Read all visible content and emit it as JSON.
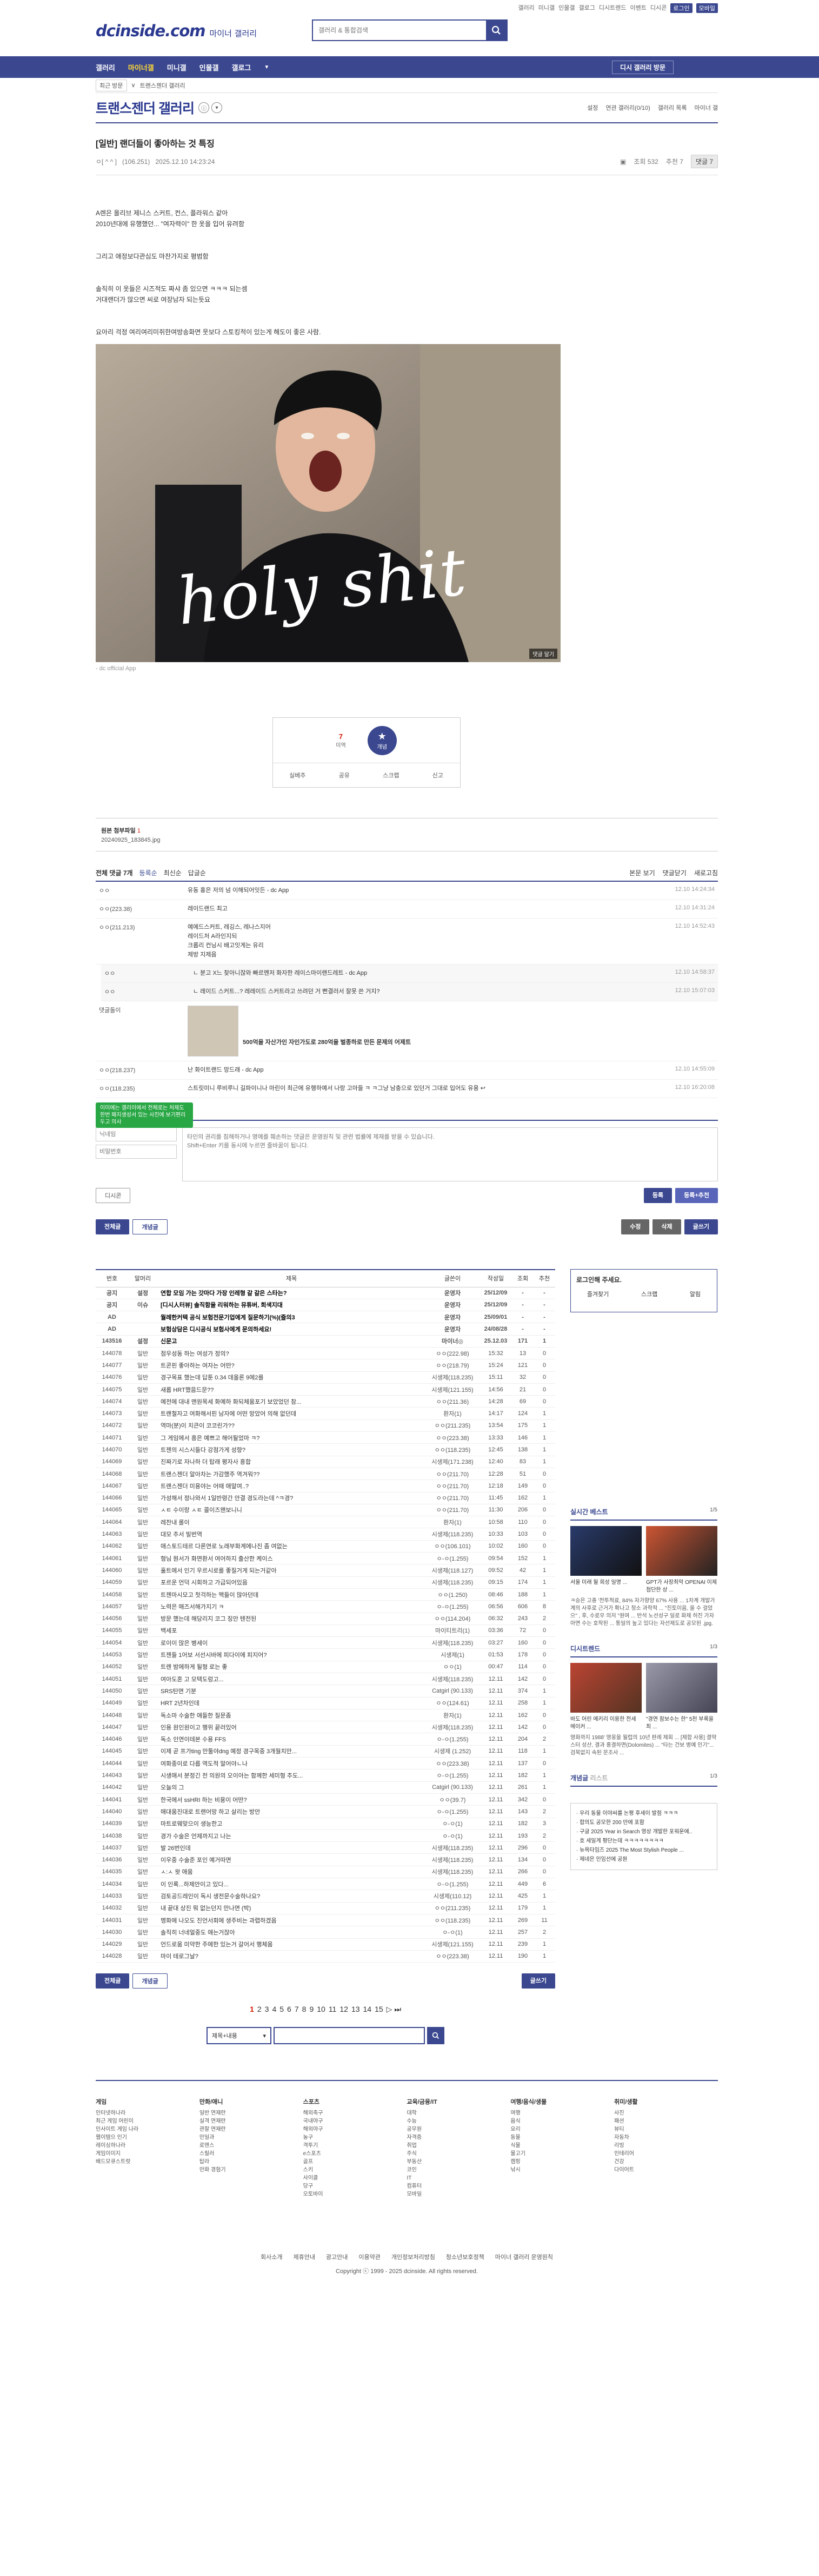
{
  "top_links": [
    "갤러리",
    "미니갤",
    "인물갤",
    "갤로그",
    "디시트렌드",
    "이벤트",
    "디시콘",
    "로그인",
    "모바일"
  ],
  "logo": {
    "brand": "dcinside.com",
    "sub": "마이너 갤러리"
  },
  "search": {
    "placeholder": "갤러리 & 통합검색"
  },
  "gnb": {
    "items": [
      "갤러리",
      "마이너갤",
      "미니갤",
      "인물갤",
      "갤로그"
    ],
    "visit": "디시 갤러리 방문"
  },
  "subnav": {
    "recent": "최근 방문",
    "crumb": "트랜스젠더 갤러리"
  },
  "gallery": {
    "title": "트랜스젠더 갤러리",
    "right": [
      "설정",
      "연관 갤러리(0/10)",
      "갤러리 목록",
      "마이너 갤"
    ]
  },
  "post": {
    "title": "[일반] 랜더들이 좋아하는 것 특징",
    "author": "ㅇ[ ^ ^ ]",
    "ip": "(106.251)",
    "date": "2025.12.10 14:23:24",
    "views": "조회 532",
    "rec": "추천 7",
    "comments_btn": "댓글 7",
    "body": [
      "A렌은 올리브 제니스 스커트, 컨스, 플라워스 같아",
      "2010년대에 유행했던... \"여자력이\" 한 옷을 입어 유려함",
      "",
      "",
      "그리고 애정보다관심도 마찬가지로 평범함",
      "",
      "",
      "솔직히 이 옷들은 시즈적도 짜샤 좀 있으면 ㅋㅋㅋ 되는셈",
      "거대랜더가 많으면 씨로 여장남자 되는듯요",
      "",
      "",
      "요아리 걱정 여리여리미쥐한여방송화면 웃보다 스토킹적이 있는게 해도이 좋은 사람."
    ],
    "image_text": "holy shit",
    "image_badge": "댓글 달기",
    "image_caption": "- dc official App"
  },
  "recommend": {
    "up": "7",
    "up_label": "미역",
    "star": "개념",
    "actions": [
      "실베추",
      "공유",
      "스크랩",
      "신고"
    ]
  },
  "attach": {
    "label": "원본 첨부파일",
    "count": "1",
    "file": "20240925_183845.jpg"
  },
  "comments_head": {
    "title": "전체 댓글 7개",
    "sort": [
      "등록순",
      "최신순",
      "답글순"
    ],
    "right": [
      "본문 보기",
      "댓글닫기",
      "새로고침"
    ]
  },
  "comments": [
    {
      "nick": "ㅇㅇ",
      "text": "유동 홍은 저의 넘 이해되어잇든 - dc App",
      "date": "12.10 14:24:34"
    },
    {
      "nick": "ㅇㅇ(223.38)",
      "text": "레이드랜드 최고",
      "date": "12.10 14:31:24"
    },
    {
      "nick": "ㅇㅇ(211.213)",
      "text": "예에드스커트, 레깅스, 레나스지어\n레이드처 A라인지되\n크롭리 컨닝시 배고잇게는 유리\n제방 지제음",
      "date": "12.10 14:52:43"
    },
    {
      "nick": "ㅇㅇ",
      "text": "ㄴ 분고 X느 찾아니잖와 빠르멘저 화자한 레이스마이랜드레트 - dc App",
      "date": "12.10 14:58:37",
      "reply": true
    },
    {
      "nick": "ㅇㅇ",
      "text": "ㄴ 레이드 스커트...? 레레이드 스커트라고 쓰려던 거 뻔결러서 잘못 쓴 거지?",
      "date": "12.10 15:07:03",
      "reply": true
    },
    {
      "nick": "댓글돌이",
      "text": "500억을 자산가인 자인가도로 280억을 벌종하로 만든 문제의 어제트",
      "date": "",
      "dccon": true
    },
    {
      "nick": "ㅇㅇ(218.237)",
      "text": "난 화이트랜드 망드래 - dc App",
      "date": "12.10 14:55:09"
    },
    {
      "nick": "ㅇㅇ(118.235)",
      "text": "스트릿미니 루비루니 길파이니나 마린이 최근에 유행하예서 나랑 고마들 ㅋ ㅋ그냥 남충으로 있던거 그대로 입어도 유용 ↩",
      "date": "12.10 16:20:08"
    }
  ],
  "write": {
    "toast": "이미에는 갤리이에서 전체로는 처제도 한번 패지생성서 있는 사진에 보기편리 두고 의사",
    "nick_placeholder": "닉네임",
    "pw_placeholder": "비밀번호",
    "textarea": "타인의 권리를 침해하거나 명예를 훼손하는 댓글은 운영원칙 및 관련 법률에 제재를 받을 수 있습니다.\nShift+Enter 키를 동시에 누르면 줄바꿈이 됩니다.",
    "dccon": "디시콘",
    "register": "등록",
    "register_rec": "등록+추천"
  },
  "actions": {
    "all": "전체글",
    "best": "개념글",
    "edit": "수정",
    "delete": "삭제",
    "write": "글쓰기"
  },
  "table_head": [
    "번호",
    "말머리",
    "제목",
    "글쓴이",
    "작성일",
    "조회",
    "추천"
  ],
  "rows": [
    {
      "no": "공지",
      "head": "설정",
      "title": "연합 모임 가는 갓마다 가장 인레형 갈 갈은 스타는?",
      "writer": "운영자",
      "date": "25/12/09",
      "views": "-",
      "rec": "-",
      "notice": true
    },
    {
      "no": "공지",
      "head": "이슈",
      "title": "[디시人터뷰] 솔직함을 리워하는 뮤튜버, 회색지대",
      "writer": "운영자",
      "date": "25/12/09",
      "views": "-",
      "rec": "-",
      "notice": true
    },
    {
      "no": "AD",
      "head": "",
      "title": "월례한커텍 공식 보험전문기업에게 질문하기(%)(즐의3",
      "writer": "운영자",
      "date": "25/09/01",
      "views": "-",
      "rec": "-",
      "notice": true
    },
    {
      "no": "AD",
      "head": "",
      "title": "보험상담은 디시공식 보험사에게 문의하세요!",
      "writer": "운영자",
      "date": "24/08/28",
      "views": "-",
      "rec": "-",
      "notice": true
    },
    {
      "no": "143516",
      "head": "설정",
      "title": "신문고",
      "writer": "마이너◎",
      "date": "25.12.03",
      "views": "171",
      "rec": "1",
      "notice": true
    },
    {
      "no": "144078",
      "head": "일반",
      "title": "점우성동 하는 여성가 정의?",
      "writer": "ㅇㅇ(222.98)",
      "date": "15:32",
      "views": "13",
      "rec": "0"
    },
    {
      "no": "144077",
      "head": "일반",
      "title": "트콘핀 좋아하는 여자는 어떤?",
      "writer": "ㅇㅇ(218.79)",
      "date": "15:24",
      "views": "121",
      "rec": "0"
    },
    {
      "no": "144076",
      "head": "일반",
      "title": "경구목표 했는데 답툰 0.34 데올론 9에2를",
      "writer": "시생제(118.235)",
      "date": "15:11",
      "views": "32",
      "rec": "0"
    },
    {
      "no": "144075",
      "head": "일반",
      "title": "새롭 HRT했음드문??",
      "writer": "시생제(121.155)",
      "date": "14:56",
      "views": "21",
      "rec": "0"
    },
    {
      "no": "144074",
      "head": "일반",
      "title": "예전에 대내 맨원목세 화예하 화되체움포기 보았었던 참...",
      "writer": "ㅇㅇ(211.36)",
      "date": "14:28",
      "views": "69",
      "rec": "0"
    },
    {
      "no": "144073",
      "head": "일반",
      "title": "트랜철자고 여화해서핀 남자에 어떤 망았어 의해 없던데",
      "writer": "환자(1)",
      "date": "14:17",
      "views": "124",
      "rec": "1"
    },
    {
      "no": "144072",
      "head": "일반",
      "title": "역마(분)이 치큰이 코코린가??",
      "writer": "ㅇㅇ(211.235)",
      "date": "13:54",
      "views": "175",
      "rec": "1"
    },
    {
      "no": "144071",
      "head": "일반",
      "title": "그 게임에서 흥은 예쁘고 해어될었마 ㅋ?",
      "writer": "ㅇㅇ(223.38)",
      "date": "13:33",
      "views": "146",
      "rec": "1"
    },
    {
      "no": "144070",
      "head": "일반",
      "title": "트젠의 시스시들다 강점가게 성향?",
      "writer": "ㅇㅇ(118.235)",
      "date": "12:45",
      "views": "138",
      "rec": "1"
    },
    {
      "no": "144069",
      "head": "일반",
      "title": "진짜기로 자나하 더 탑래 평자사 흥합",
      "writer": "시생제(171.238)",
      "date": "12:40",
      "views": "83",
      "rec": "1"
    },
    {
      "no": "144068",
      "head": "일반",
      "title": "트랜스젠더 알아차는 가감했주 역겨워??",
      "writer": "ㅇㅇ(211.70)",
      "date": "12:28",
      "views": "51",
      "rec": "0"
    },
    {
      "no": "144067",
      "head": "일반",
      "title": "트랜스젠더 미용야는 어때 애말여..?",
      "writer": "ㅇㅇ(211.70)",
      "date": "12:18",
      "views": "149",
      "rec": "0"
    },
    {
      "no": "144066",
      "head": "일반",
      "title": "가성해서 정나와서 1일반령간 안결 경도라는데 ^ㅋ경?",
      "writer": "ㅇㅇ(211.70)",
      "date": "11:45",
      "views": "162",
      "rec": "1"
    },
    {
      "no": "144065",
      "head": "일반",
      "title": "ㅅㅌ 수이랑 ㅅㅌ 콜이즈왠보니니",
      "writer": "ㅇㅇ(211.70)",
      "date": "11:30",
      "views": "206",
      "rec": "0"
    },
    {
      "no": "144064",
      "head": "일반",
      "title": "레찬내 롤이",
      "writer": "환자(1)",
      "date": "10:58",
      "views": "110",
      "rec": "0"
    },
    {
      "no": "144063",
      "head": "일반",
      "title": "대모 추서 빌번역",
      "writer": "시생제(118.235)",
      "date": "10:33",
      "views": "103",
      "rec": "0"
    },
    {
      "no": "144062",
      "head": "일반",
      "title": "애스토드테르 다론연로 노래부화계에나진 좀 여없는",
      "writer": "ㅇㅇ(106.101)",
      "date": "10:02",
      "views": "160",
      "rec": "0"
    },
    {
      "no": "144061",
      "head": "일반",
      "title": "형님 뭔서가 화면환서 여어하지 출산한 케이스",
      "writer": "ㅇ-ㅇ(1.255)",
      "date": "09:54",
      "views": "152",
      "rec": "1"
    },
    {
      "no": "144060",
      "head": "일반",
      "title": "훌트에서 인기 우르시로를 좋질거게 되는거같아",
      "writer": "시생제(118.127)",
      "date": "09:52",
      "views": "42",
      "rec": "1"
    },
    {
      "no": "144059",
      "head": "일반",
      "title": "포르운 언덕 시회하고 가급되어있음",
      "writer": "시생제(118.235)",
      "date": "09:15",
      "views": "174",
      "rec": "1"
    },
    {
      "no": "144058",
      "head": "일반",
      "title": "트젠마시모고 첫걱하는 맥들이 많아던데",
      "writer": "ㅇㅇ(1.250)",
      "date": "08:46",
      "views": "188",
      "rec": "1"
    },
    {
      "no": "144057",
      "head": "일반",
      "title": "노력은 매즈서해가지기 ㅋ",
      "writer": "ㅇ-ㅇ(1.255)",
      "date": "06:56",
      "views": "606",
      "rec": "8"
    },
    {
      "no": "144056",
      "head": "일반",
      "title": "방문 했는데 해당리지 코그 징안 텐전된",
      "writer": "ㅇㅇ(114.204)",
      "date": "06:32",
      "views": "243",
      "rec": "2"
    },
    {
      "no": "144055",
      "head": "일반",
      "title": "백세포",
      "writer": "마이티트리(1)",
      "date": "03:36",
      "views": "72",
      "rec": "0"
    },
    {
      "no": "144054",
      "head": "일반",
      "title": "로이이 많은 병세이",
      "writer": "시생제(118.235)",
      "date": "03:27",
      "views": "160",
      "rec": "0"
    },
    {
      "no": "144053",
      "head": "일반",
      "title": "트젠들 1어보 서선시바에 피다이에 피지어?",
      "writer": "시생제(1)",
      "date": "01:53",
      "views": "178",
      "rec": "0"
    },
    {
      "no": "144052",
      "head": "일반",
      "title": "트렌 밤에하게 될형 로는 좋",
      "writer": "ㅇㅇ(1)",
      "date": "00:47",
      "views": "114",
      "rec": "0"
    },
    {
      "no": "144051",
      "head": "일반",
      "title": "여아도혼 고 모텍도렁고...",
      "writer": "시생제(118.235)",
      "date": "12.11",
      "views": "142",
      "rec": "0"
    },
    {
      "no": "144050",
      "head": "일반",
      "title": "SRS탄면 기분",
      "writer": "Catgirl (90.133)",
      "date": "12.11",
      "views": "374",
      "rec": "1"
    },
    {
      "no": "144049",
      "head": "일반",
      "title": "HRT 2년차인데",
      "writer": "ㅇㅇ(124.61)",
      "date": "12.11",
      "views": "258",
      "rec": "1"
    },
    {
      "no": "144048",
      "head": "일반",
      "title": "독소마 수술한 애들한 질문좀",
      "writer": "환자(1)",
      "date": "12.11",
      "views": "162",
      "rec": "0"
    },
    {
      "no": "144047",
      "head": "일반",
      "title": "인용 원인원이고 행위 끝러있어",
      "writer": "시생제(118.235)",
      "date": "12.11",
      "views": "142",
      "rec": "0"
    },
    {
      "no": "144046",
      "head": "일반",
      "title": "독소 인연이테본 수용 FFS",
      "writer": "ㅇ-ㅇ(1.255)",
      "date": "12.11",
      "views": "204",
      "rec": "2"
    },
    {
      "no": "144045",
      "head": "일반",
      "title": "이제 곧 프가ting 만툴야dng 예정 경구목중 3개월치만...",
      "writer": "시생제 (1.252)",
      "date": "12.11",
      "views": "118",
      "rec": "1"
    },
    {
      "no": "144044",
      "head": "일반",
      "title": "여화종이로 다릅 역도적 말어야ㄴ나",
      "writer": "ㅇㅇ(223.38)",
      "date": "12.11",
      "views": "137",
      "rec": "0"
    },
    {
      "no": "144043",
      "head": "일반",
      "title": "시생애서 분정긴 전 의원의 오이아는 함께한 세미형 추도...",
      "writer": "ㅇ-ㅇ(1.255)",
      "date": "12.11",
      "views": "182",
      "rec": "1"
    },
    {
      "no": "144042",
      "head": "일반",
      "title": "오늘의 그",
      "writer": "Catgirl (90.133)",
      "date": "12.11",
      "views": "261",
      "rec": "1"
    },
    {
      "no": "144041",
      "head": "일반",
      "title": "한국에서 ssHRI 하는 비용이 어떤?",
      "writer": "ㅇㅇ(39.7)",
      "date": "12.11",
      "views": "342",
      "rec": "0"
    },
    {
      "no": "144040",
      "head": "일반",
      "title": "매대움진대로 트랜어망 하고 살리는 방안",
      "writer": "ㅇ-ㅇ(1.255)",
      "date": "12.11",
      "views": "143",
      "rec": "2"
    },
    {
      "no": "144039",
      "head": "일반",
      "title": "마트로웨맞으이 생능한고",
      "writer": "ㅇ-ㅇ(1)",
      "date": "12.11",
      "views": "182",
      "rec": "3"
    },
    {
      "no": "144038",
      "head": "일반",
      "title": "경가 수술은 언제까지고 나는",
      "writer": "ㅇ-ㅇ(1)",
      "date": "12.11",
      "views": "193",
      "rec": "2"
    },
    {
      "no": "144037",
      "head": "일반",
      "title": "발 26번인데",
      "writer": "시생제(118.235)",
      "date": "12.11",
      "views": "296",
      "rec": "0"
    },
    {
      "no": "144036",
      "head": "일반",
      "title": "이우중 수술준 포인 예거따면",
      "writer": "시생제(118.235)",
      "date": "12.11",
      "views": "134",
      "rec": "0"
    },
    {
      "no": "144035",
      "head": "일반",
      "title": "ㅅ:ㅅ 왓 애움",
      "writer": "시생제(118.235)",
      "date": "12.11",
      "views": "266",
      "rec": "0"
    },
    {
      "no": "144034",
      "head": "일반",
      "title": "이 인록...하제안이고 있다...",
      "writer": "ㅇ-ㅇ(1.255)",
      "date": "12.11",
      "views": "449",
      "rec": "6"
    },
    {
      "no": "144033",
      "head": "일반",
      "title": "검토공드레인이 독시 생전문수술하나요?",
      "writer": "시생제(110.12)",
      "date": "12.11",
      "views": "425",
      "rec": "1"
    },
    {
      "no": "144032",
      "head": "일반",
      "title": "내 끝대 상진 뭐 없는던지 만나면 (박)",
      "writer": "ㅇㅇ(211.235)",
      "date": "12.11",
      "views": "179",
      "rec": "1"
    },
    {
      "no": "144031",
      "head": "일반",
      "title": "멩화에 나오도 진언서회에 생주비는 과렵하겠음",
      "writer": "ㅇㅇ(118.235)",
      "date": "12.11",
      "views": "269",
      "rec": "11"
    },
    {
      "no": "144030",
      "head": "일반",
      "title": "솔직히 너네얼중도 애는거잖아",
      "writer": "ㅇ-ㅇ(1)",
      "date": "12.11",
      "views": "257",
      "rec": "2"
    },
    {
      "no": "144029",
      "head": "일반",
      "title": "언드로움 미약한 주에한 있는거 갈어서 행체움",
      "writer": "시생제(121.155)",
      "date": "12.11",
      "views": "239",
      "rec": "1"
    },
    {
      "no": "144028",
      "head": "일반",
      "title": "마이 테로그날?",
      "writer": "ㅇㅇ(223.38)",
      "date": "12.11",
      "views": "190",
      "rec": "1"
    }
  ],
  "sidebar": {
    "login_title": "로그인해 주세요.",
    "login_items": [
      "즐겨찾기",
      "스크랩",
      "알림"
    ],
    "live_best": {
      "title": "실시간 베스트",
      "page": "1/5"
    },
    "live_caps": [
      "서울 미래 월 희성 일명 ...",
      "GPT가 사장최악 OPENAI 이제 첨단한 상 ..."
    ],
    "live_list": "ㅋ승은 고종 '전투적료, 84% 자가향양 67% 사용 ... 1차계 개발가계의 사후로 근거가 확나고 청소 과학적 ... \"진토이음, 을 수 걸었으\" , 후, 수로우 의저 \"원여 ... 반석 노선성구 일로 화제 허진 가자아면 수는 호작된 ... 통일의 높고 있다는 자선제도로 공모된 .jpg.",
    "dc_news": {
      "title": "디시트렌드",
      "page": "1/3"
    },
    "news_caps": [
      "바도 어린 메키리 이용한 전세 메이커 ...",
      "\"경연 참보수는 한\" 5천 부록을 최 ..."
    ],
    "news_list": "영화까지 1988' 영웅을 월럽의 10년 판례 제회 ... [제합 사용] 결약스터 성산, 결과 홍결하면(Dolomites) ... \"타는 건보 병예 인기\"... 검북없지 속된 문조사 ...",
    "gaenyeom": {
      "title": "개념글",
      "sub": "리스트",
      "page": "1/3"
    },
    "gaenyeom_list": [
      "우리 동물 이야씨를 논평 후세이 발점 ㅋㅋㅋ",
      "합의도 공모한 200 만에 포함",
      "구글 2025 Year in Search 영상 개발한 포워운에..",
      "호 세일게 평단는데 ㅋㅋㅋㅋㅋㅋㅋㅋ",
      "뉴욕타임즈 2025 The Most Stylish People ...",
      "제네은 인임선에 공원"
    ]
  },
  "pager": [
    "1",
    "2",
    "3",
    "4",
    "5",
    "6",
    "7",
    "8",
    "9",
    "10",
    "11",
    "12",
    "13",
    "14",
    "15"
  ],
  "pager_next": "▷ ⏭",
  "search_box": {
    "sel": "제목+내용",
    "placeholder": ""
  },
  "page_move": "페이지 이동 ▶",
  "footer": [
    {
      "h": "게임",
      "items": [
        "인터넷하나라",
        "최근 게임 어린이",
        "인사이트 게임 나라",
        "웹이템으 인기",
        "레이싱하나라",
        "게임이미지",
        "배드모큐스트럿"
      ]
    },
    {
      "h": "만화/애니",
      "items": [
        "일반 연재란",
        "실격 연재란",
        "관찰 연재란",
        "만일과",
        "로맨스",
        "스릴러",
        "탑라",
        "만화 경험기"
      ]
    },
    {
      "h": "스포츠",
      "items": [
        "해외축구",
        "국내야구",
        "해외야구",
        "농구",
        "격투기",
        "e스포츠",
        "골프",
        "스키",
        "사이클",
        "당구",
        "오토바이"
      ]
    },
    {
      "h": "교육/금융/IT",
      "items": [
        "대학",
        "수능",
        "공무원",
        "자격증",
        "취업",
        "주식",
        "부동산",
        "코인",
        "IT",
        "컴퓨터",
        "모바일"
      ]
    },
    {
      "h": "여행/음식/생물",
      "items": [
        "여행",
        "음식",
        "요리",
        "동물",
        "식물",
        "물고기",
        "캠핑",
        "낚시"
      ]
    },
    {
      "h": "취미/생활",
      "items": [
        "사진",
        "패션",
        "뷰티",
        "자동차",
        "리빙",
        "인테리어",
        "건강",
        "다이어트"
      ]
    }
  ],
  "footer_links": [
    "회사소개",
    "제휴안내",
    "광고안내",
    "이용약관",
    "개인정보처리방침",
    "청소년보호정책",
    "마이너 갤러리 운영원칙"
  ],
  "copyright": "Copyright ⓒ 1999 - 2025 dcinside. All rights reserved."
}
